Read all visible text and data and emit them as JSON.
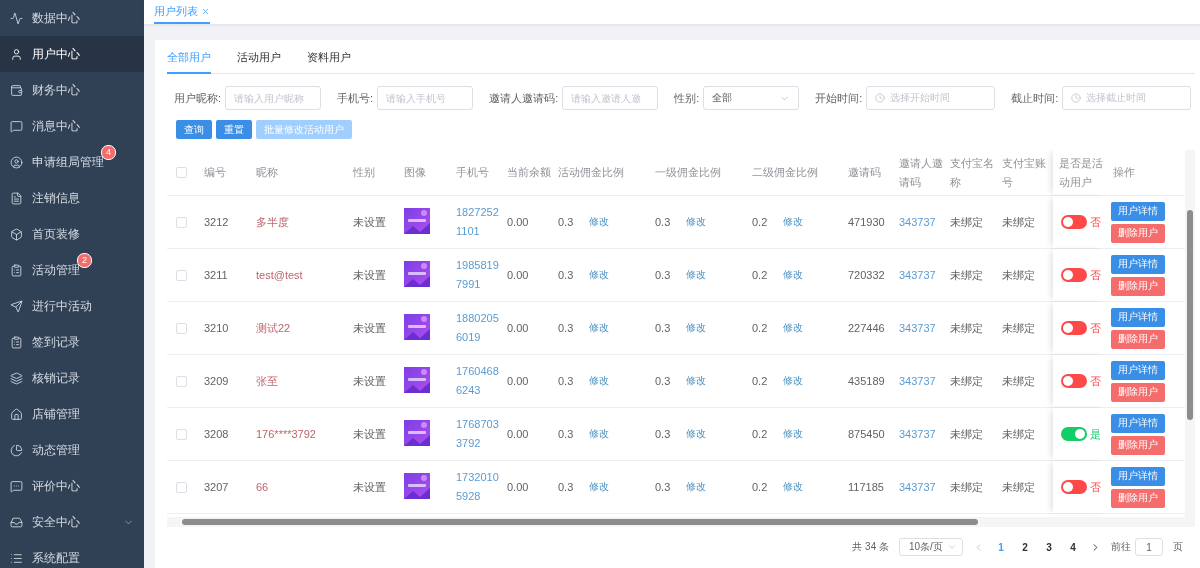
{
  "sidebar": {
    "items": [
      {
        "label": "数据中心",
        "selected": false,
        "kind": "link"
      },
      {
        "label": "用户中心",
        "selected": true,
        "kind": "link"
      },
      {
        "label": "财务中心",
        "selected": false,
        "kind": "link"
      },
      {
        "label": "消息中心",
        "selected": false,
        "kind": "link"
      },
      {
        "label": "申请组局管理",
        "selected": false,
        "kind": "link",
        "badge": "4"
      },
      {
        "label": "注销信息",
        "selected": false,
        "kind": "link"
      },
      {
        "label": "首页装修",
        "selected": false,
        "kind": "link"
      },
      {
        "label": "活动管理",
        "selected": false,
        "kind": "link",
        "badge": "2"
      },
      {
        "label": "进行中活动",
        "selected": false,
        "kind": "link"
      },
      {
        "label": "签到记录",
        "selected": false,
        "kind": "link"
      },
      {
        "label": "核销记录",
        "selected": false,
        "kind": "link"
      },
      {
        "label": "店铺管理",
        "selected": false,
        "kind": "link"
      },
      {
        "label": "动态管理",
        "selected": false,
        "kind": "link"
      },
      {
        "label": "评价中心",
        "selected": false,
        "kind": "link"
      },
      {
        "label": "安全中心",
        "selected": false,
        "kind": "submenu"
      },
      {
        "label": "系统配置",
        "selected": false,
        "kind": "link"
      }
    ]
  },
  "page_tabs": [
    {
      "label": "用户列表",
      "selected": true,
      "closable": true
    }
  ],
  "sub_tabs": [
    {
      "label": "全部用户",
      "selected": true
    },
    {
      "label": "活动用户",
      "selected": false
    },
    {
      "label": "资料用户",
      "selected": false
    }
  ],
  "filters": [
    {
      "kind": "text",
      "label": "用户昵称:",
      "placeholder": "请输入用户昵称"
    },
    {
      "kind": "text",
      "label": "手机号:",
      "placeholder": "请输入手机号"
    },
    {
      "kind": "text",
      "label": "邀请人邀请码:",
      "placeholder": "请输入邀请人邀"
    },
    {
      "kind": "select",
      "label": "性别:",
      "value": "全部"
    },
    {
      "kind": "date",
      "label": "开始时间:",
      "placeholder": "选择开始时间"
    },
    {
      "kind": "date",
      "label": "截止时间:",
      "placeholder": "选择截止时间"
    }
  ],
  "buttons": [
    {
      "label": "查询",
      "disabled": false
    },
    {
      "label": "重置",
      "disabled": false
    },
    {
      "label": "批量修改活动用户",
      "disabled": true
    }
  ],
  "table": {
    "all_checked": false,
    "columns": [
      "编号",
      "昵称",
      "性别",
      "图像",
      "手机号",
      "当前余额",
      "活动佣金比例",
      "一级佣金比例",
      "二级佣金比例",
      "邀请码",
      "邀请人邀请码",
      "支付宝名称",
      "支付宝账号",
      "是否是活动用户",
      "操作"
    ],
    "rows": [
      {
        "checked": false,
        "id": "3212",
        "nickname": "多半度",
        "gender": "未设置",
        "avatar": {
          "kind": "picture"
        },
        "phone": "18272521101",
        "balance": "0.00",
        "activity_ratio": {
          "value": "0.3",
          "action": "修改"
        },
        "level1_ratio": {
          "value": "0.3",
          "action": "修改"
        },
        "level2_ratio": {
          "value": "0.2",
          "action": "修改"
        },
        "invite_code": "471930",
        "inviter_code": "343737",
        "alipay_name": "未绑定",
        "alipay_account": "未绑定",
        "active": {
          "on": false,
          "label": "否"
        },
        "actions": [
          "用户详情",
          "删除用户"
        ]
      },
      {
        "checked": false,
        "id": "3211",
        "nickname": "test@test",
        "gender": "未设置",
        "avatar": {
          "kind": "picture"
        },
        "phone": "19858197991",
        "balance": "0.00",
        "activity_ratio": {
          "value": "0.3",
          "action": "修改"
        },
        "level1_ratio": {
          "value": "0.3",
          "action": "修改"
        },
        "level2_ratio": {
          "value": "0.2",
          "action": "修改"
        },
        "invite_code": "720332",
        "inviter_code": "343737",
        "alipay_name": "未绑定",
        "alipay_account": "未绑定",
        "active": {
          "on": false,
          "label": "否"
        },
        "actions": [
          "用户详情",
          "删除用户"
        ]
      },
      {
        "checked": false,
        "id": "3210",
        "nickname": "测试22",
        "gender": "未设置",
        "avatar": {
          "kind": "picture"
        },
        "phone": "18802056019",
        "balance": "0.00",
        "activity_ratio": {
          "value": "0.3",
          "action": "修改"
        },
        "level1_ratio": {
          "value": "0.3",
          "action": "修改"
        },
        "level2_ratio": {
          "value": "0.2",
          "action": "修改"
        },
        "invite_code": "227446",
        "inviter_code": "343737",
        "alipay_name": "未绑定",
        "alipay_account": "未绑定",
        "active": {
          "on": false,
          "label": "否"
        },
        "actions": [
          "用户详情",
          "删除用户"
        ]
      },
      {
        "checked": false,
        "id": "3209",
        "nickname": "张至",
        "gender": "未设置",
        "avatar": {
          "kind": "picture"
        },
        "phone": "17604686243",
        "balance": "0.00",
        "activity_ratio": {
          "value": "0.3",
          "action": "修改"
        },
        "level1_ratio": {
          "value": "0.3",
          "action": "修改"
        },
        "level2_ratio": {
          "value": "0.2",
          "action": "修改"
        },
        "invite_code": "435189",
        "inviter_code": "343737",
        "alipay_name": "未绑定",
        "alipay_account": "未绑定",
        "active": {
          "on": false,
          "label": "否"
        },
        "actions": [
          "用户详情",
          "删除用户"
        ]
      },
      {
        "checked": false,
        "id": "3208",
        "nickname": "176****3792",
        "gender": "未设置",
        "avatar": {
          "kind": "picture"
        },
        "phone": "17687033792",
        "balance": "0.00",
        "activity_ratio": {
          "value": "0.3",
          "action": "修改"
        },
        "level1_ratio": {
          "value": "0.3",
          "action": "修改"
        },
        "level2_ratio": {
          "value": "0.2",
          "action": "修改"
        },
        "invite_code": "875450",
        "inviter_code": "343737",
        "alipay_name": "未绑定",
        "alipay_account": "未绑定",
        "active": {
          "on": true,
          "label": "是"
        },
        "actions": [
          "用户详情",
          "删除用户"
        ]
      },
      {
        "checked": false,
        "id": "3207",
        "nickname": "66",
        "gender": "未设置",
        "avatar": {
          "kind": "picture"
        },
        "phone": "17320105928",
        "balance": "0.00",
        "activity_ratio": {
          "value": "0.3",
          "action": "修改"
        },
        "level1_ratio": {
          "value": "0.3",
          "action": "修改"
        },
        "level2_ratio": {
          "value": "0.2",
          "action": "修改"
        },
        "invite_code": "117185",
        "inviter_code": "343737",
        "alipay_name": "未绑定",
        "alipay_account": "未绑定",
        "active": {
          "on": false,
          "label": "否"
        },
        "actions": [
          "用户详情",
          "删除用户"
        ]
      }
    ]
  },
  "pagination": {
    "total": "共 34 条",
    "page_size": "10条/页",
    "pages": [
      {
        "label": "1",
        "selected": true
      },
      {
        "label": "2",
        "selected": false
      },
      {
        "label": "3",
        "selected": false
      },
      {
        "label": "4",
        "selected": false
      }
    ],
    "goto_label": "前往",
    "goto_value": "1",
    "page_unit": "页"
  }
}
